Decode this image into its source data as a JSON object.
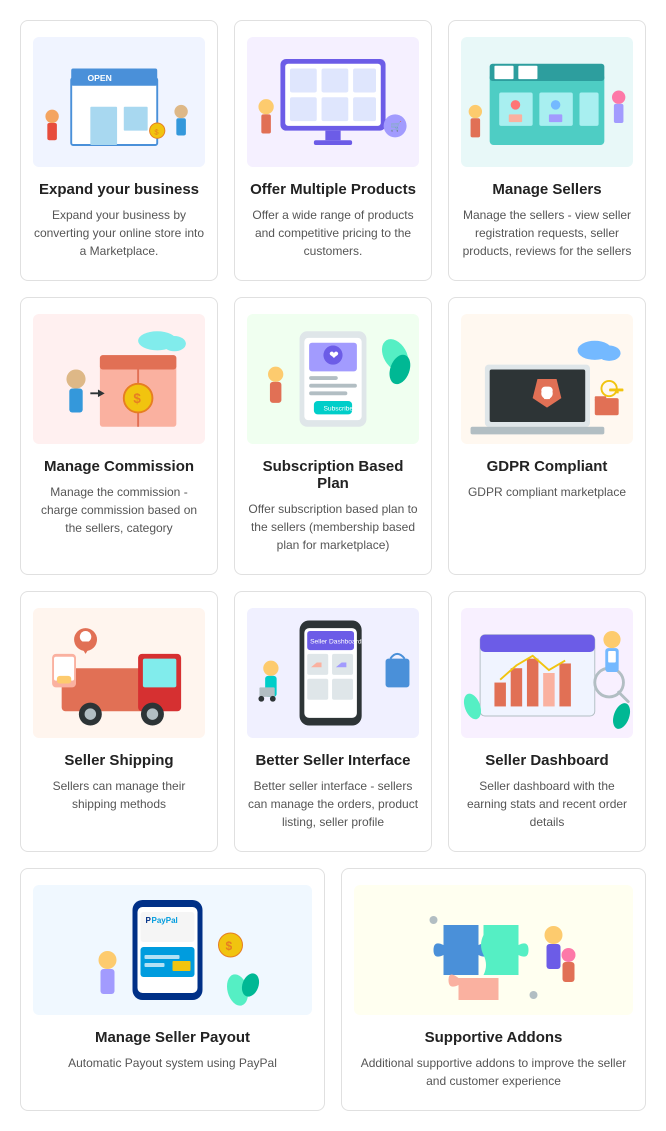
{
  "cards": [
    {
      "id": "expand-business",
      "title": "Expand your business",
      "desc": "Expand your business by converting your online store into a Marketplace.",
      "bg": "#f0f4ff",
      "illustration": "store"
    },
    {
      "id": "offer-products",
      "title": "Offer Multiple Products",
      "desc": "Offer a wide range of products and competitive pricing to the customers.",
      "bg": "#f5f0ff",
      "illustration": "products"
    },
    {
      "id": "manage-sellers",
      "title": "Manage Sellers",
      "desc": "Manage the sellers - view seller registration requests, seller products, reviews for the sellers",
      "bg": "#e8f8f8",
      "illustration": "sellers"
    },
    {
      "id": "manage-commission",
      "title": "Manage Commission",
      "desc": "Manage the commission - charge commission based on the sellers, category",
      "bg": "#fff0f0",
      "illustration": "commission"
    },
    {
      "id": "subscription-plan",
      "title": "Subscription Based Plan",
      "desc": "Offer subscription based plan to the sellers (membership based plan for marketplace)",
      "bg": "#f0fff5",
      "illustration": "subscription"
    },
    {
      "id": "gdpr-compliant",
      "title": "GDPR Compliant",
      "desc": "GDPR compliant marketplace",
      "bg": "#fff8f0",
      "illustration": "gdpr"
    },
    {
      "id": "seller-shipping",
      "title": "Seller Shipping",
      "desc": "Sellers can manage their shipping methods",
      "bg": "#fff5ee",
      "illustration": "shipping"
    },
    {
      "id": "better-interface",
      "title": "Better Seller Interface",
      "desc": "Better seller interface - sellers can manage the orders, product listing, seller profile",
      "bg": "#f0f0ff",
      "illustration": "interface"
    },
    {
      "id": "seller-dashboard",
      "title": "Seller Dashboard",
      "desc": "Seller dashboard with the earning stats and recent order details",
      "bg": "#f8f0ff",
      "illustration": "dashboard"
    },
    {
      "id": "manage-payout",
      "title": "Manage Seller Payout",
      "desc": "Automatic Payout system using PayPal",
      "bg": "#f0f8ff",
      "illustration": "payout"
    },
    {
      "id": "supportive-addons",
      "title": "Supportive Addons",
      "desc": "Additional supportive addons to improve the seller and customer experience",
      "bg": "#fffff0",
      "illustration": "addons"
    }
  ]
}
